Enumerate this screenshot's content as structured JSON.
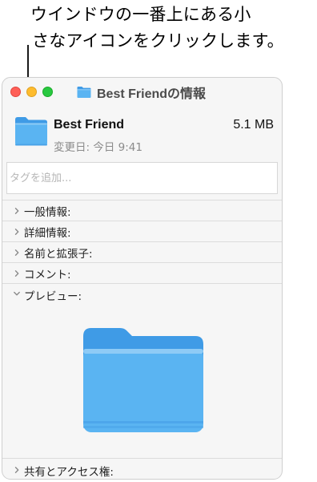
{
  "callout": {
    "line1": "ウインドウの一番上にある小",
    "line2": "さなアイコンをクリックします。"
  },
  "window": {
    "title": "Best Friendの情報",
    "title_icon": "folder-icon",
    "traffic_lights": [
      "close",
      "minimize",
      "zoom"
    ]
  },
  "file": {
    "name": "Best Friend",
    "size": "5.1 MB",
    "modified": "変更日: 今日 9:41",
    "icon": "folder-icon"
  },
  "tags": {
    "placeholder": "タグを追加..."
  },
  "sections": [
    {
      "label": "一般情報:",
      "expanded": false
    },
    {
      "label": "詳細情報:",
      "expanded": false
    },
    {
      "label": "名前と拡張子:",
      "expanded": false
    },
    {
      "label": "コメント:",
      "expanded": false
    },
    {
      "label": "プレビュー:",
      "expanded": true
    },
    {
      "label": "共有とアクセス権:",
      "expanded": false
    }
  ],
  "colors": {
    "folder_front": "#5ab4f2",
    "folder_back": "#3f9be6",
    "close": "#fe5f57",
    "minimize": "#febc2e",
    "zoom": "#28c840"
  }
}
